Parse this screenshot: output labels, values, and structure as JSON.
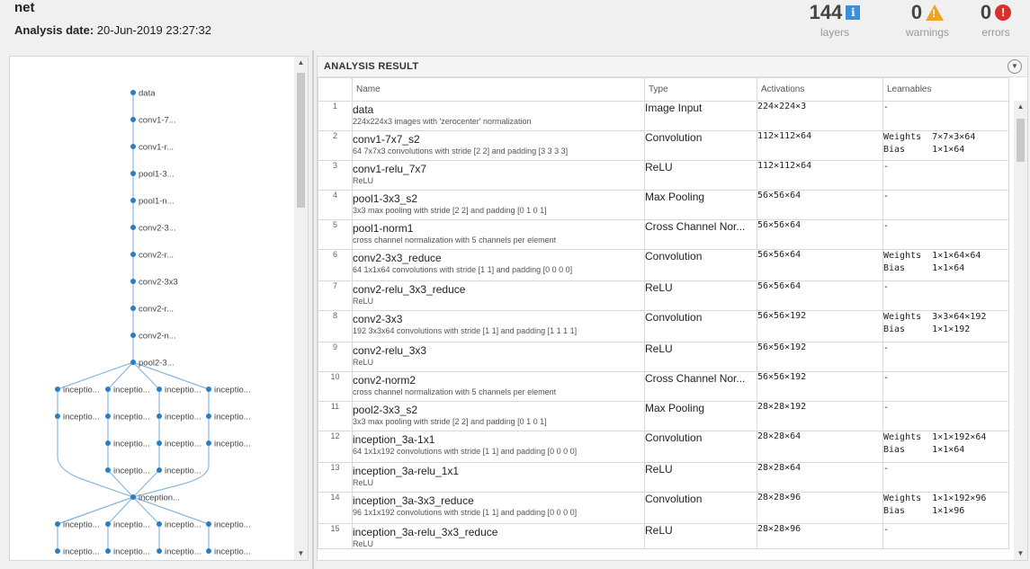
{
  "header": {
    "title": "net",
    "date_label": "Analysis date:",
    "date_value": "20-Jun-2019 23:27:32",
    "layers": {
      "count": "144",
      "label": "layers",
      "icon": "info-icon"
    },
    "warnings": {
      "count": "0",
      "label": "warnings",
      "icon": "warning-icon"
    },
    "errors": {
      "count": "0",
      "label": "errors",
      "icon": "error-icon"
    }
  },
  "graph": {
    "nodes": [
      "data",
      "conv1-7...",
      "conv1-r...",
      "pool1-3...",
      "pool1-n...",
      "conv2-3...",
      "conv2-r...",
      "conv2-3x3",
      "conv2-r...",
      "conv2-n...",
      "pool2-3...",
      "inceptio...",
      "inception..."
    ],
    "branch_label": "inceptio...",
    "node_color": "#2a7fc4",
    "edge_color": "#8ab8e0"
  },
  "analysis": {
    "title": "ANALYSIS RESULT",
    "columns": [
      "Name",
      "Type",
      "Activations",
      "Learnables"
    ],
    "rows": [
      {
        "idx": "1",
        "name": "data",
        "desc": "224x224x3 images with 'zerocenter' normalization",
        "type": "Image Input",
        "act": "224×224×3",
        "learn": "-"
      },
      {
        "idx": "2",
        "name": "conv1-7x7_s2",
        "desc": "64 7x7x3 convolutions with stride [2  2] and padding [3  3  3  3]",
        "type": "Convolution",
        "act": "112×112×64",
        "learn": "Weights  7×7×3×64\nBias     1×1×64"
      },
      {
        "idx": "3",
        "name": "conv1-relu_7x7",
        "desc": "ReLU",
        "type": "ReLU",
        "act": "112×112×64",
        "learn": "-"
      },
      {
        "idx": "4",
        "name": "pool1-3x3_s2",
        "desc": "3x3 max pooling with stride [2  2] and padding [0  1  0  1]",
        "type": "Max Pooling",
        "act": "56×56×64",
        "learn": "-"
      },
      {
        "idx": "5",
        "name": "pool1-norm1",
        "desc": "cross channel normalization with 5 channels per element",
        "type": "Cross Channel Nor...",
        "act": "56×56×64",
        "learn": "-"
      },
      {
        "idx": "6",
        "name": "conv2-3x3_reduce",
        "desc": "64 1x1x64 convolutions with stride [1  1] and padding [0  0  0  0]",
        "type": "Convolution",
        "act": "56×56×64",
        "learn": "Weights  1×1×64×64\nBias     1×1×64"
      },
      {
        "idx": "7",
        "name": "conv2-relu_3x3_reduce",
        "desc": "ReLU",
        "type": "ReLU",
        "act": "56×56×64",
        "learn": "-"
      },
      {
        "idx": "8",
        "name": "conv2-3x3",
        "desc": "192 3x3x64 convolutions with stride [1  1] and padding [1  1  1  1]",
        "type": "Convolution",
        "act": "56×56×192",
        "learn": "Weights  3×3×64×192\nBias     1×1×192"
      },
      {
        "idx": "9",
        "name": "conv2-relu_3x3",
        "desc": "ReLU",
        "type": "ReLU",
        "act": "56×56×192",
        "learn": "-"
      },
      {
        "idx": "10",
        "name": "conv2-norm2",
        "desc": "cross channel normalization with 5 channels per element",
        "type": "Cross Channel Nor...",
        "act": "56×56×192",
        "learn": "-"
      },
      {
        "idx": "11",
        "name": "pool2-3x3_s2",
        "desc": "3x3 max pooling with stride [2  2] and padding [0  1  0  1]",
        "type": "Max Pooling",
        "act": "28×28×192",
        "learn": "-"
      },
      {
        "idx": "12",
        "name": "inception_3a-1x1",
        "desc": "64 1x1x192 convolutions with stride [1  1] and padding [0  0  0  0]",
        "type": "Convolution",
        "act": "28×28×64",
        "learn": "Weights  1×1×192×64\nBias     1×1×64"
      },
      {
        "idx": "13",
        "name": "inception_3a-relu_1x1",
        "desc": "ReLU",
        "type": "ReLU",
        "act": "28×28×64",
        "learn": "-"
      },
      {
        "idx": "14",
        "name": "inception_3a-3x3_reduce",
        "desc": "96 1x1x192 convolutions with stride [1  1] and padding [0  0  0  0]",
        "type": "Convolution",
        "act": "28×28×96",
        "learn": "Weights  1×1×192×96\nBias     1×1×96"
      },
      {
        "idx": "15",
        "name": "inception_3a-relu_3x3_reduce",
        "desc": "ReLU",
        "type": "ReLU",
        "act": "28×28×96",
        "learn": "-"
      }
    ]
  }
}
